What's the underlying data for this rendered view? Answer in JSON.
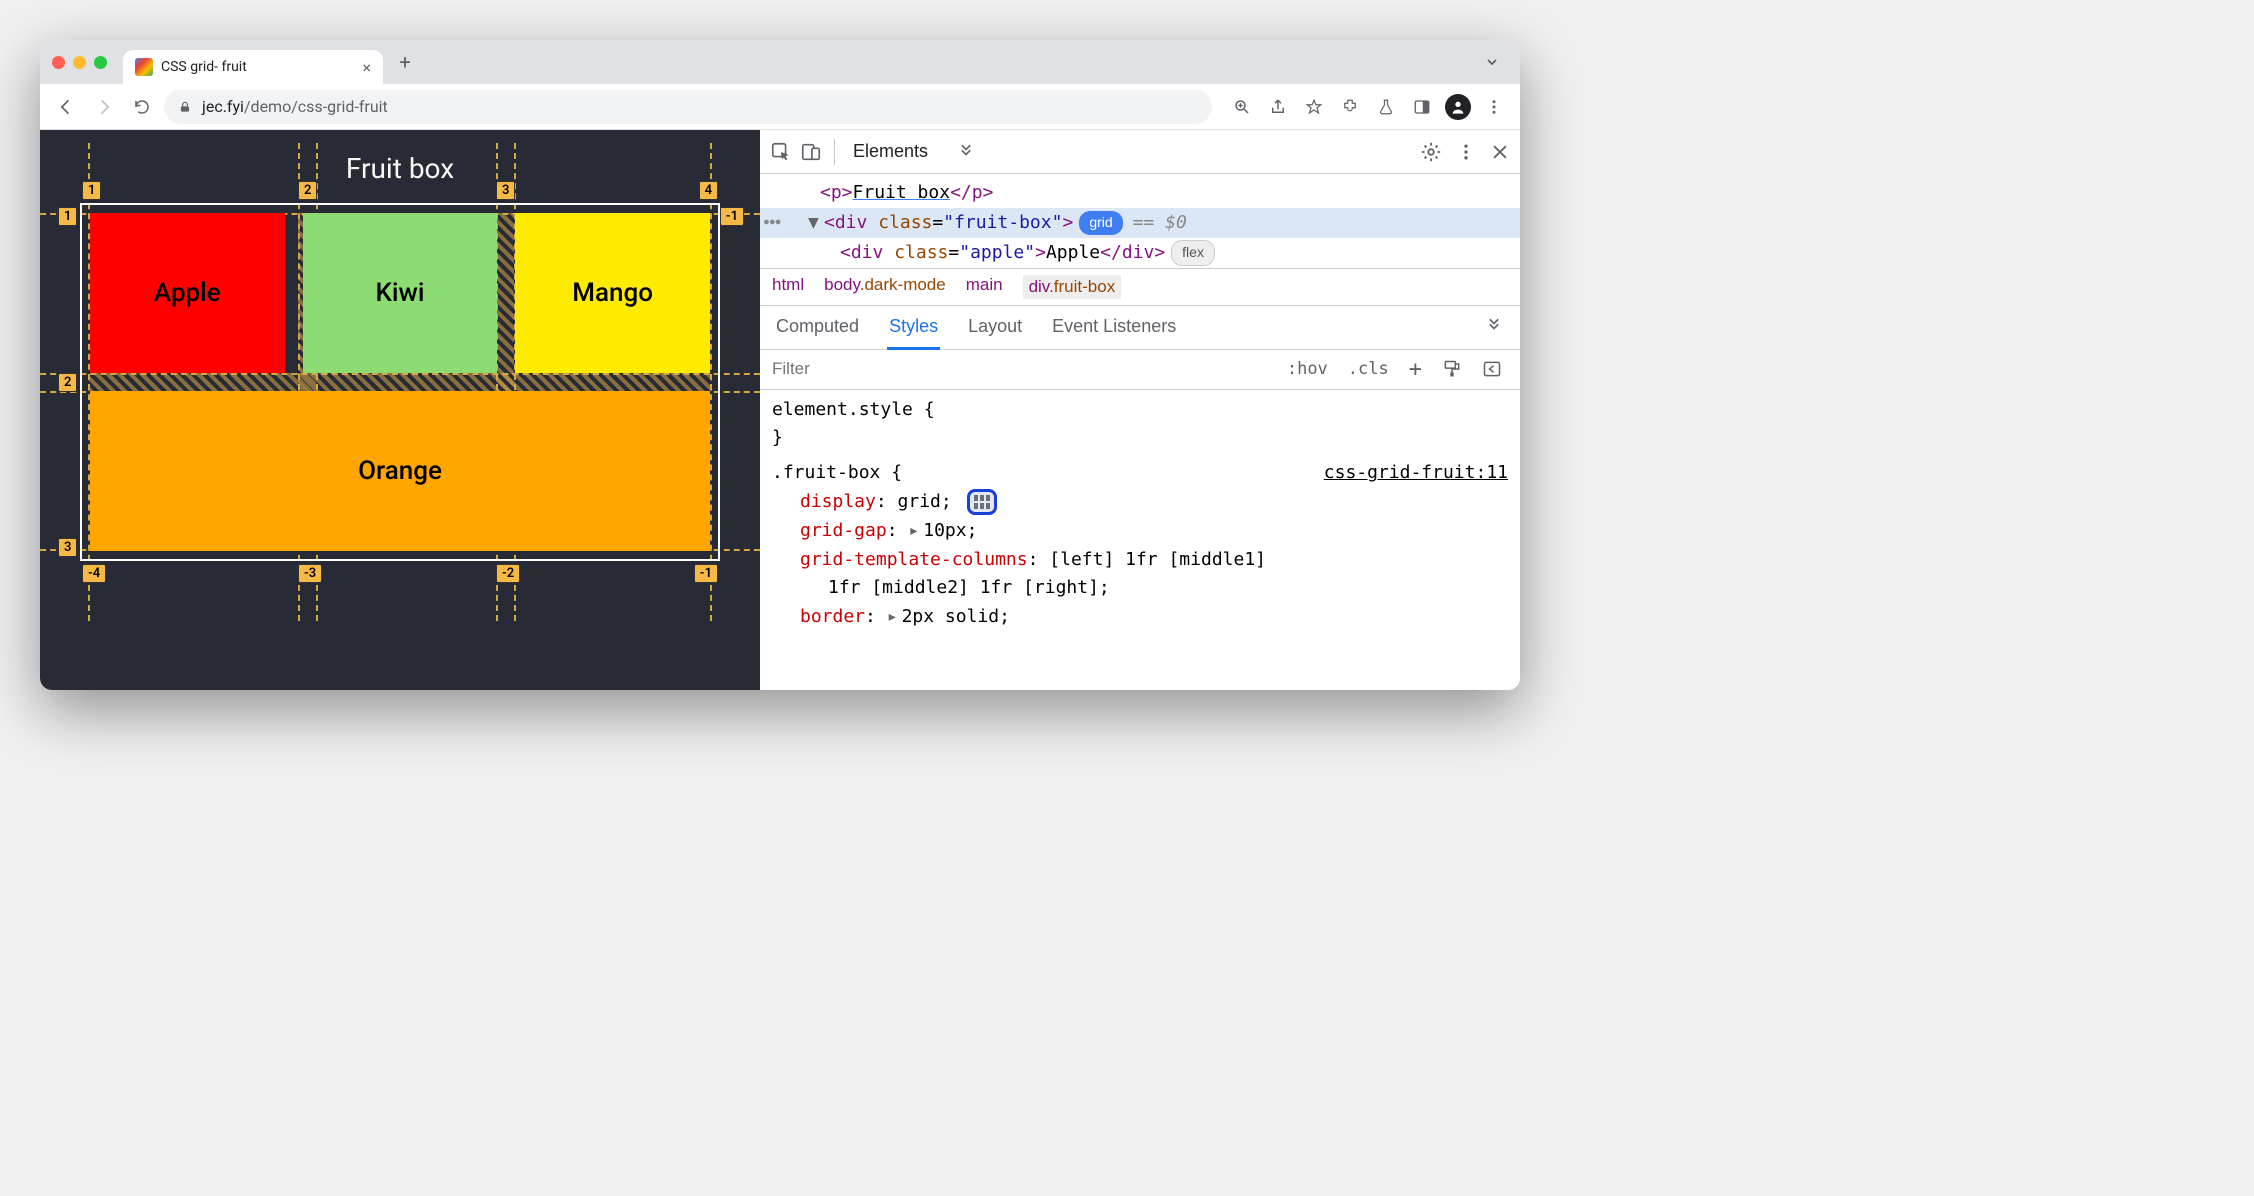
{
  "browser": {
    "tab_title": "CSS grid- fruit",
    "url_host": "jec.fyi",
    "url_path": "/demo/css-grid-fruit"
  },
  "page": {
    "heading": "Fruit box",
    "cells": {
      "apple": "Apple",
      "kiwi": "Kiwi",
      "mango": "Mango",
      "orange": "Orange"
    },
    "grid_labels": {
      "col_pos": [
        "1",
        "2",
        "3",
        "4"
      ],
      "row_pos": [
        "1",
        "2",
        "3"
      ],
      "col_neg": [
        "-4",
        "-3",
        "-2",
        "-1"
      ],
      "row_neg": [
        "-1"
      ]
    }
  },
  "devtools": {
    "panel": "Elements",
    "dom": {
      "line1_text": "Fruit box",
      "line2_class": "fruit-box",
      "line2_badge": "grid",
      "line2_suffix": "== $0",
      "line3_class": "apple",
      "line3_text": "Apple",
      "line3_badge": "flex"
    },
    "breadcrumb": [
      "html",
      "body.dark-mode",
      "main",
      "div.fruit-box"
    ],
    "subtabs": [
      "Computed",
      "Styles",
      "Layout",
      "Event Listeners"
    ],
    "filter_placeholder": "Filter",
    "filter_buttons": {
      "hov": ":hov",
      "cls": ".cls"
    },
    "styles": {
      "element_style": "element.style {",
      "element_style_close": "}",
      "rule_selector": ".fruit-box {",
      "rule_source": "css-grid-fruit:11",
      "props": {
        "display": {
          "name": "display",
          "value": "grid"
        },
        "grid_gap": {
          "name": "grid-gap",
          "value": "10px"
        },
        "grid_template_columns": {
          "name": "grid-template-columns",
          "value": "[left] 1fr [middle1]"
        },
        "grid_template_columns_cont": "1fr [middle2] 1fr [right];",
        "border": {
          "name": "border",
          "value": "2px solid"
        }
      }
    }
  }
}
